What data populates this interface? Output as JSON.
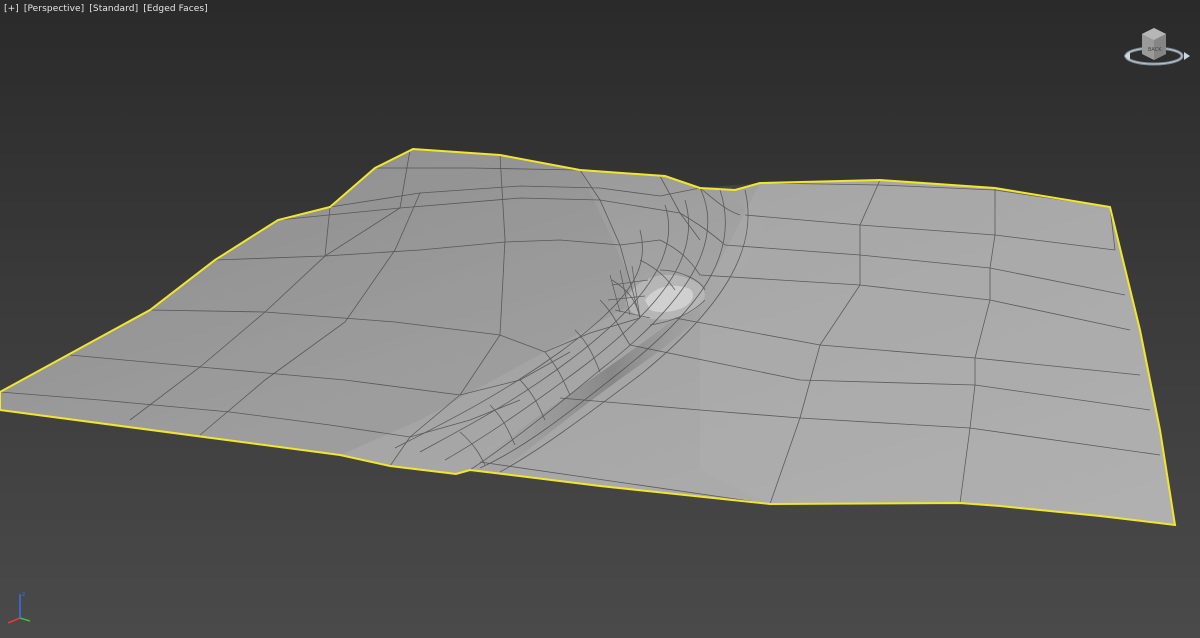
{
  "viewport": {
    "menus": [
      {
        "label": "[+]"
      },
      {
        "label": "[Perspective]"
      },
      {
        "label": "[Standard]"
      },
      {
        "label": "[Edged Faces]"
      }
    ],
    "view_mode": "Perspective",
    "shading_mode": "Standard",
    "display_mode": "Edged Faces",
    "selection_color": "#f2e62c",
    "mesh_color": "#a0a0a0",
    "wire_color": "#4a4a4a"
  },
  "viewcube": {
    "icon": "viewcube-icon",
    "face_label": "BACK"
  },
  "axis_tripod": {
    "icon": "axis-tripod-icon",
    "axes": [
      {
        "name": "z",
        "color": "#3a6df0"
      },
      {
        "name": "x",
        "color": "#e23b3b"
      },
      {
        "name": "y",
        "color": "#3bbf3b"
      }
    ]
  }
}
